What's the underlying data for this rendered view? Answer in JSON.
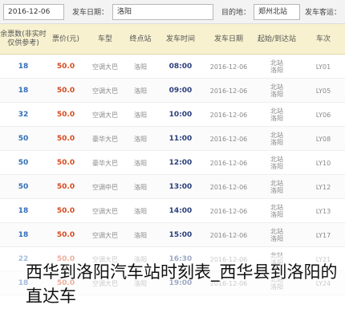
{
  "search": {
    "date_value": "2016-12-06",
    "arrive_date_label": "发车日期：",
    "arrive_date_value": "2016-12-06",
    "dest_value": "洛阳",
    "dest_label": "目的地：",
    "origin_value": "郑州北站",
    "origin_label": "发车客运："
  },
  "table": {
    "headers": {
      "seats": "余票数(非实时 仅供参考)",
      "price": "票价(元)",
      "type": "车型",
      "dest": "终点站",
      "dep_time": "发车时间",
      "dep_date": "发车日期",
      "route": "起始/到达站",
      "bus_no": "车次"
    },
    "rows": [
      {
        "seats": "18",
        "price": "50.0",
        "type": "空调大巴",
        "dest": "洛阳",
        "time": "08:00",
        "date": "2016-12-06",
        "from": "北站",
        "to": "洛阳",
        "no": "LY01"
      },
      {
        "seats": "18",
        "price": "50.0",
        "type": "空调大巴",
        "dest": "洛阳",
        "time": "09:00",
        "date": "2016-12-06",
        "from": "北站",
        "to": "洛阳",
        "no": "LY05"
      },
      {
        "seats": "32",
        "price": "50.0",
        "type": "空调大巴",
        "dest": "洛阳",
        "time": "10:00",
        "date": "2016-12-06",
        "from": "北站",
        "to": "洛阳",
        "no": "LY06"
      },
      {
        "seats": "50",
        "price": "50.0",
        "type": "豪华大巴",
        "dest": "洛阳",
        "time": "11:00",
        "date": "2016-12-06",
        "from": "北站",
        "to": "洛阳",
        "no": "LY08"
      },
      {
        "seats": "50",
        "price": "50.0",
        "type": "豪华大巴",
        "dest": "洛阳",
        "time": "12:00",
        "date": "2016-12-06",
        "from": "北站",
        "to": "洛阳",
        "no": "LY10"
      },
      {
        "seats": "50",
        "price": "50.0",
        "type": "空调中巴",
        "dest": "洛阳",
        "time": "13:00",
        "date": "2016-12-06",
        "from": "北站",
        "to": "洛阳",
        "no": "LY12"
      },
      {
        "seats": "18",
        "price": "50.0",
        "type": "空调大巴",
        "dest": "洛阳",
        "time": "14:00",
        "date": "2016-12-06",
        "from": "北站",
        "to": "洛阳",
        "no": "LY13"
      },
      {
        "seats": "18",
        "price": "50.0",
        "type": "空调大巴",
        "dest": "洛阳",
        "time": "15:00",
        "date": "2016-12-06",
        "from": "北站",
        "to": "洛阳",
        "no": "LY17"
      },
      {
        "seats": "22",
        "price": "50.0",
        "type": "空调大巴",
        "dest": "洛阳",
        "time": "16:30",
        "date": "2016-12-06",
        "from": "北站",
        "to": "洛阳",
        "no": "LY21"
      },
      {
        "seats": "18",
        "price": "50.0",
        "type": "空调大巴",
        "dest": "洛阳",
        "time": "19:00",
        "date": "2016-12-06",
        "from": "北站",
        "to": "洛阳",
        "no": "LY24"
      }
    ]
  },
  "caption": "西华到洛阳汽车站时刻表_西华县到洛阳的直达车"
}
